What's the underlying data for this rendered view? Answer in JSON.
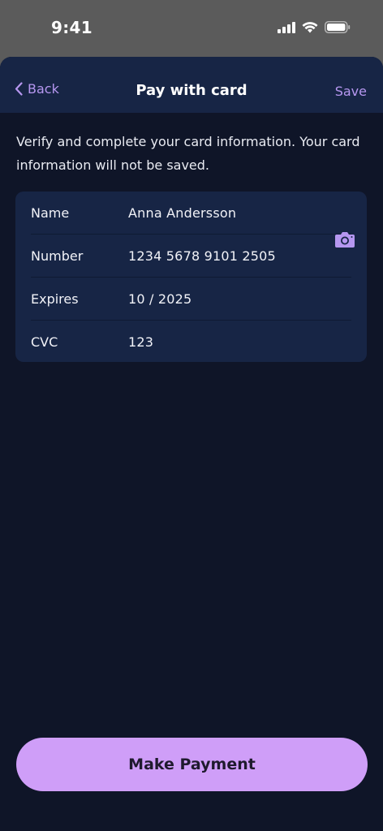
{
  "status_bar": {
    "time": "9:41",
    "icons": [
      "cellular-signal-icon",
      "wifi-icon",
      "battery-icon"
    ]
  },
  "nav": {
    "back_label": "Back",
    "title": "Pay with card",
    "save_label": "Save"
  },
  "description": "Verify and complete your card information. Your card information will not be saved.",
  "form": {
    "rows": [
      {
        "label": "Name",
        "value": "Anna Andersson"
      },
      {
        "label": "Number",
        "value": "1234 5678 9101 2505"
      },
      {
        "label": "Expires",
        "value": "10 / 2025"
      },
      {
        "label": "CVC",
        "value": "123"
      }
    ],
    "scan_icon": "camera-icon"
  },
  "actions": {
    "pay_label": "Make Payment"
  },
  "colors": {
    "accent": "#b697f0",
    "button": "#cf9ef8",
    "background": "#0f1528",
    "surface": "#172545"
  }
}
